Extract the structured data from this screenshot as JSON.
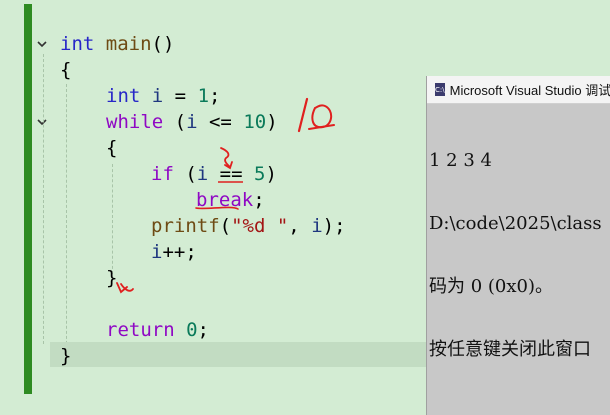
{
  "code": {
    "l1": {
      "kw": "int",
      "fn": "main",
      "rest": "()"
    },
    "l2": {
      "t": "{"
    },
    "l3": {
      "kw": "int",
      "var": "i",
      "op": " = ",
      "num": "1",
      "end": ";"
    },
    "l4": {
      "kw": "while",
      "p1": " (",
      "var": "i",
      "op": " <= ",
      "num": "10",
      "end": ")"
    },
    "l5": {
      "t": "{"
    },
    "l6": {
      "kw": "if",
      "p1": " (",
      "var": "i",
      "op": " == ",
      "num": "5",
      "end": ")"
    },
    "l7": {
      "kw": "break",
      "end": ";"
    },
    "l8": {
      "fn": "printf",
      "p1": "(",
      "str": "\"%d \"",
      "p2": ", ",
      "var": "i",
      "end": ");"
    },
    "l9": {
      "var": "i",
      "end": "++;"
    },
    "l10": {
      "t": "}"
    },
    "l11": {
      "kw": "return",
      "sp": " ",
      "num": "0",
      "end": ";"
    },
    "l12": {
      "t": "}"
    }
  },
  "annotation": {
    "note": "10"
  },
  "console": {
    "title": "Microsoft Visual Studio 调试",
    "icon": "console-app-icon",
    "icon_text": "C:\\",
    "lines": [
      "1 2 3 4",
      "D:\\code\\2025\\class",
      "码为 0 (0x0)。",
      "按任意键关闭此窗口"
    ]
  },
  "colors": {
    "keyword": "#2727c8",
    "function": "#6e4b14",
    "variable": "#1f377f",
    "number": "#0a7a5a",
    "string": "#a31515",
    "ink": "#e0201f",
    "gutter": "#2e8b22"
  }
}
